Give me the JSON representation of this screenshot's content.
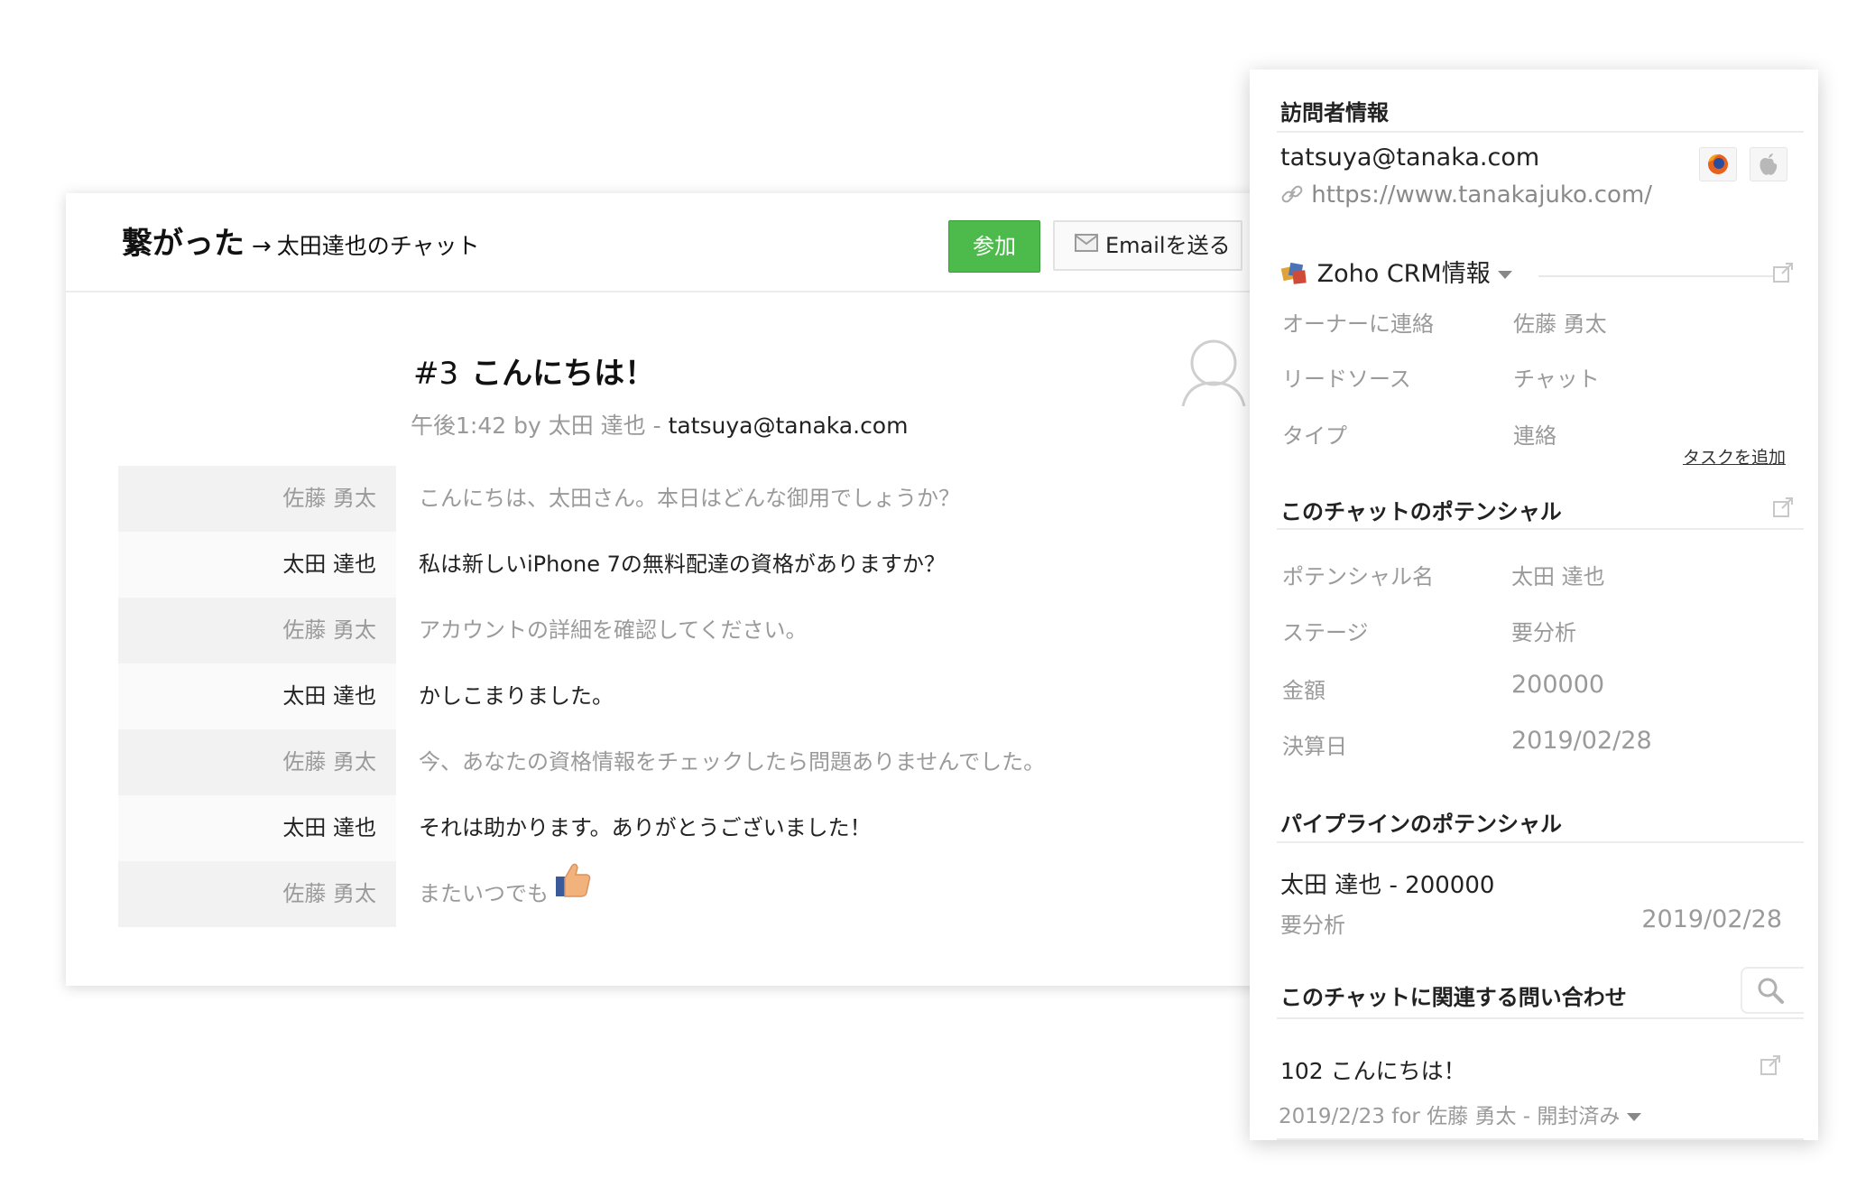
{
  "chat": {
    "title_main": "繋がった",
    "title_arrow": "→",
    "title_sub": "太田達也のチャット",
    "join_button": "参加",
    "email_button": "Emailを送る",
    "ticket_number": "#3",
    "ticket_subject": "こんにちは！",
    "meta_prefix": "午後1:42 by 太田 達也 - ",
    "meta_email": "tatsuya@tanaka.com",
    "messages": [
      {
        "role": "agent",
        "name": "佐藤 勇太",
        "text": "こんにちは、太田さん。本日はどんな御用でしょうか？"
      },
      {
        "role": "visitor",
        "name": "太田 達也",
        "text": "私は新しいiPhone 7の無料配達の資格がありますか？"
      },
      {
        "role": "agent",
        "name": "佐藤 勇太",
        "text": "アカウントの詳細を確認してください。"
      },
      {
        "role": "visitor",
        "name": "太田 達也",
        "text": "かしこまりました。"
      },
      {
        "role": "agent",
        "name": "佐藤 勇太",
        "text": "今、あなたの資格情報をチェックしたら問題ありませんでした。"
      },
      {
        "role": "visitor",
        "name": "太田 達也",
        "text": "それは助かります。ありがとうございました！"
      },
      {
        "role": "agent",
        "name": "佐藤 勇太",
        "text": "またいつでも"
      }
    ]
  },
  "panel": {
    "visitor_info_title": "訪問者情報",
    "visitor_email": "tatsuya@tanaka.com",
    "visitor_url": "https://www.tanakajuko.com/",
    "crm_title": "Zoho CRM情報",
    "crm_fields": [
      {
        "label": "オーナーに連絡",
        "value": "佐藤 勇太"
      },
      {
        "label": "リードソース",
        "value": "チャット"
      },
      {
        "label": "タイプ",
        "value": "連絡"
      }
    ],
    "add_task": "タスクを追加",
    "potential_title": "このチャットのポテンシャル",
    "potential_fields": [
      {
        "label": "ポテンシャル名",
        "value": "太田 達也"
      },
      {
        "label": "ステージ",
        "value": "要分析"
      },
      {
        "label": "金額",
        "value": "200000"
      },
      {
        "label": "決算日",
        "value": "2019/02/28"
      }
    ],
    "pipeline_title": "パイプラインのポテンシャル",
    "pipeline_name": "太田 達也 - 200000",
    "pipeline_stage": "要分析",
    "pipeline_date": "2019/02/28",
    "inquiries_title": "このチャットに関連する問い合わせ",
    "inquiry_title": "102 こんにちは！",
    "inquiry_meta": "2019/2/23 for 佐藤 勇太 - 開封済み"
  },
  "colors": {
    "join_green": "#4dbb4b",
    "agent_row_bg": "#f2f2f2",
    "muted_text": "#9a9a9a"
  }
}
